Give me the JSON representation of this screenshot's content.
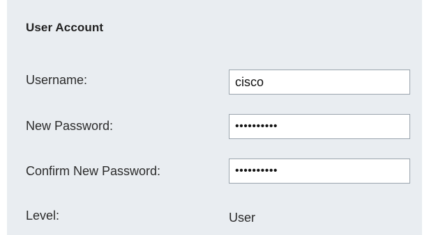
{
  "section": {
    "title": "User Account"
  },
  "form": {
    "username": {
      "label": "Username:",
      "value": "cisco"
    },
    "new_password": {
      "label": "New Password:",
      "value": "**********"
    },
    "confirm_password": {
      "label": "Confirm New Password:",
      "value": "**********"
    },
    "level": {
      "label": "Level:",
      "value": "User"
    }
  }
}
